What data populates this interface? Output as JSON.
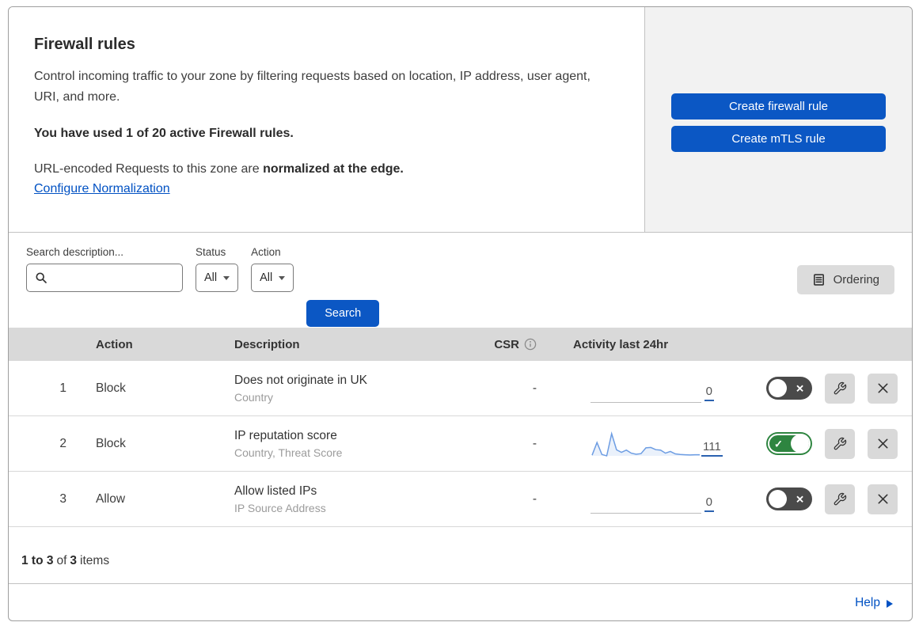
{
  "intro": {
    "title": "Firewall rules",
    "description": "Control incoming traffic to your zone by filtering requests based on location, IP address, user agent, URI, and more.",
    "usage_notice": "You have used 1 of 20 active Firewall rules.",
    "normalization_prefix": "URL-encoded Requests to this zone are ",
    "normalization_emphasis": "normalized at the edge.",
    "normalization_link": "Configure Normalization"
  },
  "actions": {
    "create_firewall_rule": "Create firewall rule",
    "create_mtls_rule": "Create mTLS rule"
  },
  "filters": {
    "search_label": "Search description...",
    "status_label": "Status",
    "status_value": "All",
    "action_label": "Action",
    "action_value": "All",
    "search_button": "Search",
    "ordering_button": "Ordering"
  },
  "table": {
    "headers": {
      "action": "Action",
      "description": "Description",
      "csr": "CSR",
      "activity": "Activity last 24hr"
    },
    "rows": [
      {
        "priority": "1",
        "action": "Block",
        "description": "Does not originate in UK",
        "criteria": "Country",
        "csr": "-",
        "activity_count": "0",
        "enabled": false
      },
      {
        "priority": "2",
        "action": "Block",
        "description": "IP reputation score",
        "criteria": "Country, Threat Score",
        "csr": "-",
        "activity_count": "111",
        "enabled": true,
        "sparkline": [
          3,
          60,
          6,
          0,
          100,
          27,
          16,
          26,
          12,
          7,
          10,
          36,
          38,
          28,
          26,
          12,
          20,
          9,
          6,
          5,
          4,
          5,
          5
        ]
      },
      {
        "priority": "3",
        "action": "Allow",
        "description": "Allow listed IPs",
        "criteria": "IP Source Address",
        "csr": "-",
        "activity_count": "0",
        "enabled": false
      }
    ]
  },
  "pagination": {
    "range": "1 to 3",
    "of_label": "of",
    "total": "3",
    "items_label": "items"
  },
  "help": {
    "label": "Help"
  },
  "chart_data": {
    "type": "line",
    "title": "Activity last 24hr sparkline (rule 2)",
    "values": [
      3,
      60,
      6,
      0,
      100,
      27,
      16,
      26,
      12,
      7,
      10,
      36,
      38,
      28,
      26,
      12,
      20,
      9,
      6,
      5,
      4,
      5,
      5
    ],
    "total_label": "111",
    "ylim": [
      0,
      100
    ]
  },
  "colors": {
    "primary_button_blue": "#0b57c4",
    "link_blue": "#0051c3",
    "toggle_on_green": "#2e8540",
    "toggle_off_gray": "#4a4a4a",
    "table_header_gray": "#d9d9d9",
    "side_panel_gray": "#f2f2f2",
    "secondary_button_gray": "#dcdcdc",
    "sparkline_blue": "#6d9de3",
    "count_underline_blue": "#2b62b0"
  }
}
